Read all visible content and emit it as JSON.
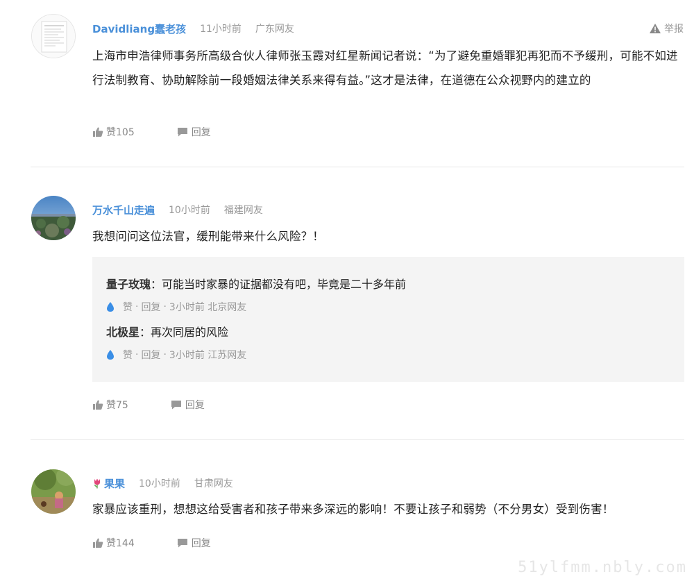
{
  "comments": [
    {
      "user": "Davidliang蠢老孩",
      "time": "11小时前",
      "location": "广东网友",
      "report": "举报",
      "text": "上海市申浩律师事务所高级合伙人律师张玉霞对红星新闻记者说：“为了避免重婚罪犯再犯而不予缓刑，可能不如进行法制教育、协助解除前一段婚姻法律关系来得有益。”这才是法律，在道德在公众视野内的建立的",
      "like": "赞105",
      "reply": "回复"
    },
    {
      "user": "万水千山走遍",
      "time": "10小时前",
      "location": "福建网友",
      "text": "我想问问这位法官，缓刑能带来什么风险？！",
      "replies": [
        {
          "name": "量子玫瑰",
          "text": "：可能当时家暴的证据都没有吧，毕竟是二十多年前",
          "like": "赞",
          "dot": "·",
          "reply": "回复",
          "meta": "3小时前 北京网友"
        },
        {
          "name": "北极星",
          "text": "：再次同居的风险",
          "like": "赞",
          "dot": "·",
          "reply": "回复",
          "meta": "3小时前 江苏网友"
        }
      ],
      "like": "赞75",
      "reply": "回复"
    },
    {
      "user": "果果",
      "time": "10小时前",
      "location": "甘肃网友",
      "text": "家暴应该重刑，想想这给受害者和孩子带来多深远的影响！不要让孩子和弱势（不分男女）受到伤害！",
      "like": "赞144",
      "reply": "回复"
    }
  ],
  "watermark": "51ylfmm.nbly.com",
  "colors": {
    "username": "#406599",
    "username_alt": "#4a90d9",
    "meta": "#999999",
    "reply_bg": "#f4f4f4",
    "like_drop": "#3a8ee6"
  }
}
